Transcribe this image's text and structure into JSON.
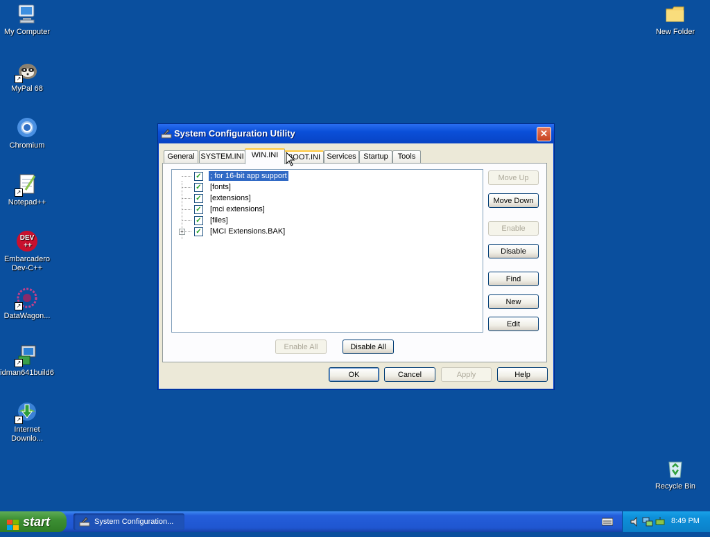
{
  "desktop": {
    "icons_left": [
      {
        "label": "My Computer",
        "icon": "computer-icon"
      },
      {
        "label": "MyPal 68",
        "icon": "raccoon-browser-icon"
      },
      {
        "label": "Chromium",
        "icon": "chromium-icon"
      },
      {
        "label": "Notepad++",
        "icon": "notepad-plus-plus-icon"
      },
      {
        "label": "Embarcadero Dev-C++",
        "icon": "dev-cpp-icon"
      },
      {
        "label": "DataWagon...",
        "icon": "datawagon-icon"
      },
      {
        "label": "idman641build6",
        "icon": "installer-icon"
      },
      {
        "label": "Internet Downlo...",
        "icon": "internet-download-manager-icon"
      }
    ],
    "icons_right": [
      {
        "label": "New Folder",
        "icon": "folder-icon"
      },
      {
        "label": "Recycle Bin",
        "icon": "recycle-bin-icon"
      }
    ],
    "dev_badge": "DEV",
    "dev_plus": "++"
  },
  "window": {
    "title": "System Configuration Utility",
    "close_glyph": "✕",
    "tabs": [
      "General",
      "SYSTEM.INI",
      "WIN.INI",
      "BOOT.INI",
      "Services",
      "Startup",
      "Tools"
    ],
    "active_tab": "WIN.INI",
    "tree_items": [
      {
        "text": "; for 16-bit app support",
        "checked": true,
        "selected": true
      },
      {
        "text": "[fonts]",
        "checked": true
      },
      {
        "text": "[extensions]",
        "checked": true
      },
      {
        "text": "[mci extensions]",
        "checked": true
      },
      {
        "text": "[files]",
        "checked": true
      },
      {
        "text": "[MCI Extensions.BAK]",
        "checked": true,
        "expandable": true
      }
    ],
    "side_buttons": {
      "move_up": "Move Up",
      "move_down": "Move Down",
      "enable": "Enable",
      "disable": "Disable",
      "find": "Find",
      "new": "New",
      "edit": "Edit"
    },
    "bottom_buttons": {
      "enable_all": "Enable All",
      "disable_all": "Disable All"
    },
    "footer_buttons": {
      "ok": "OK",
      "cancel": "Cancel",
      "apply": "Apply",
      "help": "Help"
    }
  },
  "taskbar": {
    "start_label": "start",
    "task_item": "System Configuration...",
    "clock": "8:49 PM"
  },
  "colors": {
    "desktop": "#0a4f9e",
    "title_blue": "#0a4fd8",
    "selection": "#316ac5"
  }
}
